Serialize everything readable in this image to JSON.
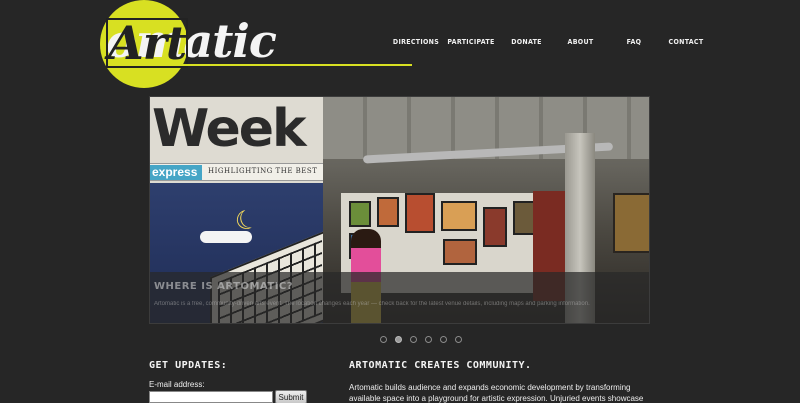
{
  "logo": {
    "part1": "Art",
    "part2": "omatic",
    "accent_color": "#d8e022"
  },
  "nav": {
    "items": [
      "DIRECTIONS",
      "PARTICIPATE",
      "DONATE",
      "ABOUT",
      "FAQ",
      "CONTACT"
    ]
  },
  "slideshow": {
    "magazine_word": "Week",
    "magazine_tag": "express",
    "magazine_tagline": "HIGHLIGHTING THE BEST",
    "caption_title": "WHERE IS ARTOMATIC?",
    "caption_text": "Artomatic is a free, community-driven arts event. The location changes each year — check back for the latest venue details, including maps and parking information.",
    "slide_count": 6,
    "active_index": 1
  },
  "updates": {
    "title": "GET UPDATES:",
    "email_label": "E-mail address:",
    "email_value": "",
    "submit_label": "Submit"
  },
  "community": {
    "title": "ARTOMATIC CREATES COMMUNITY.",
    "text": "Artomatic builds audience and expands economic development by transforming available space into a playground for artistic expression. Unjuried events showcase creative work in"
  }
}
